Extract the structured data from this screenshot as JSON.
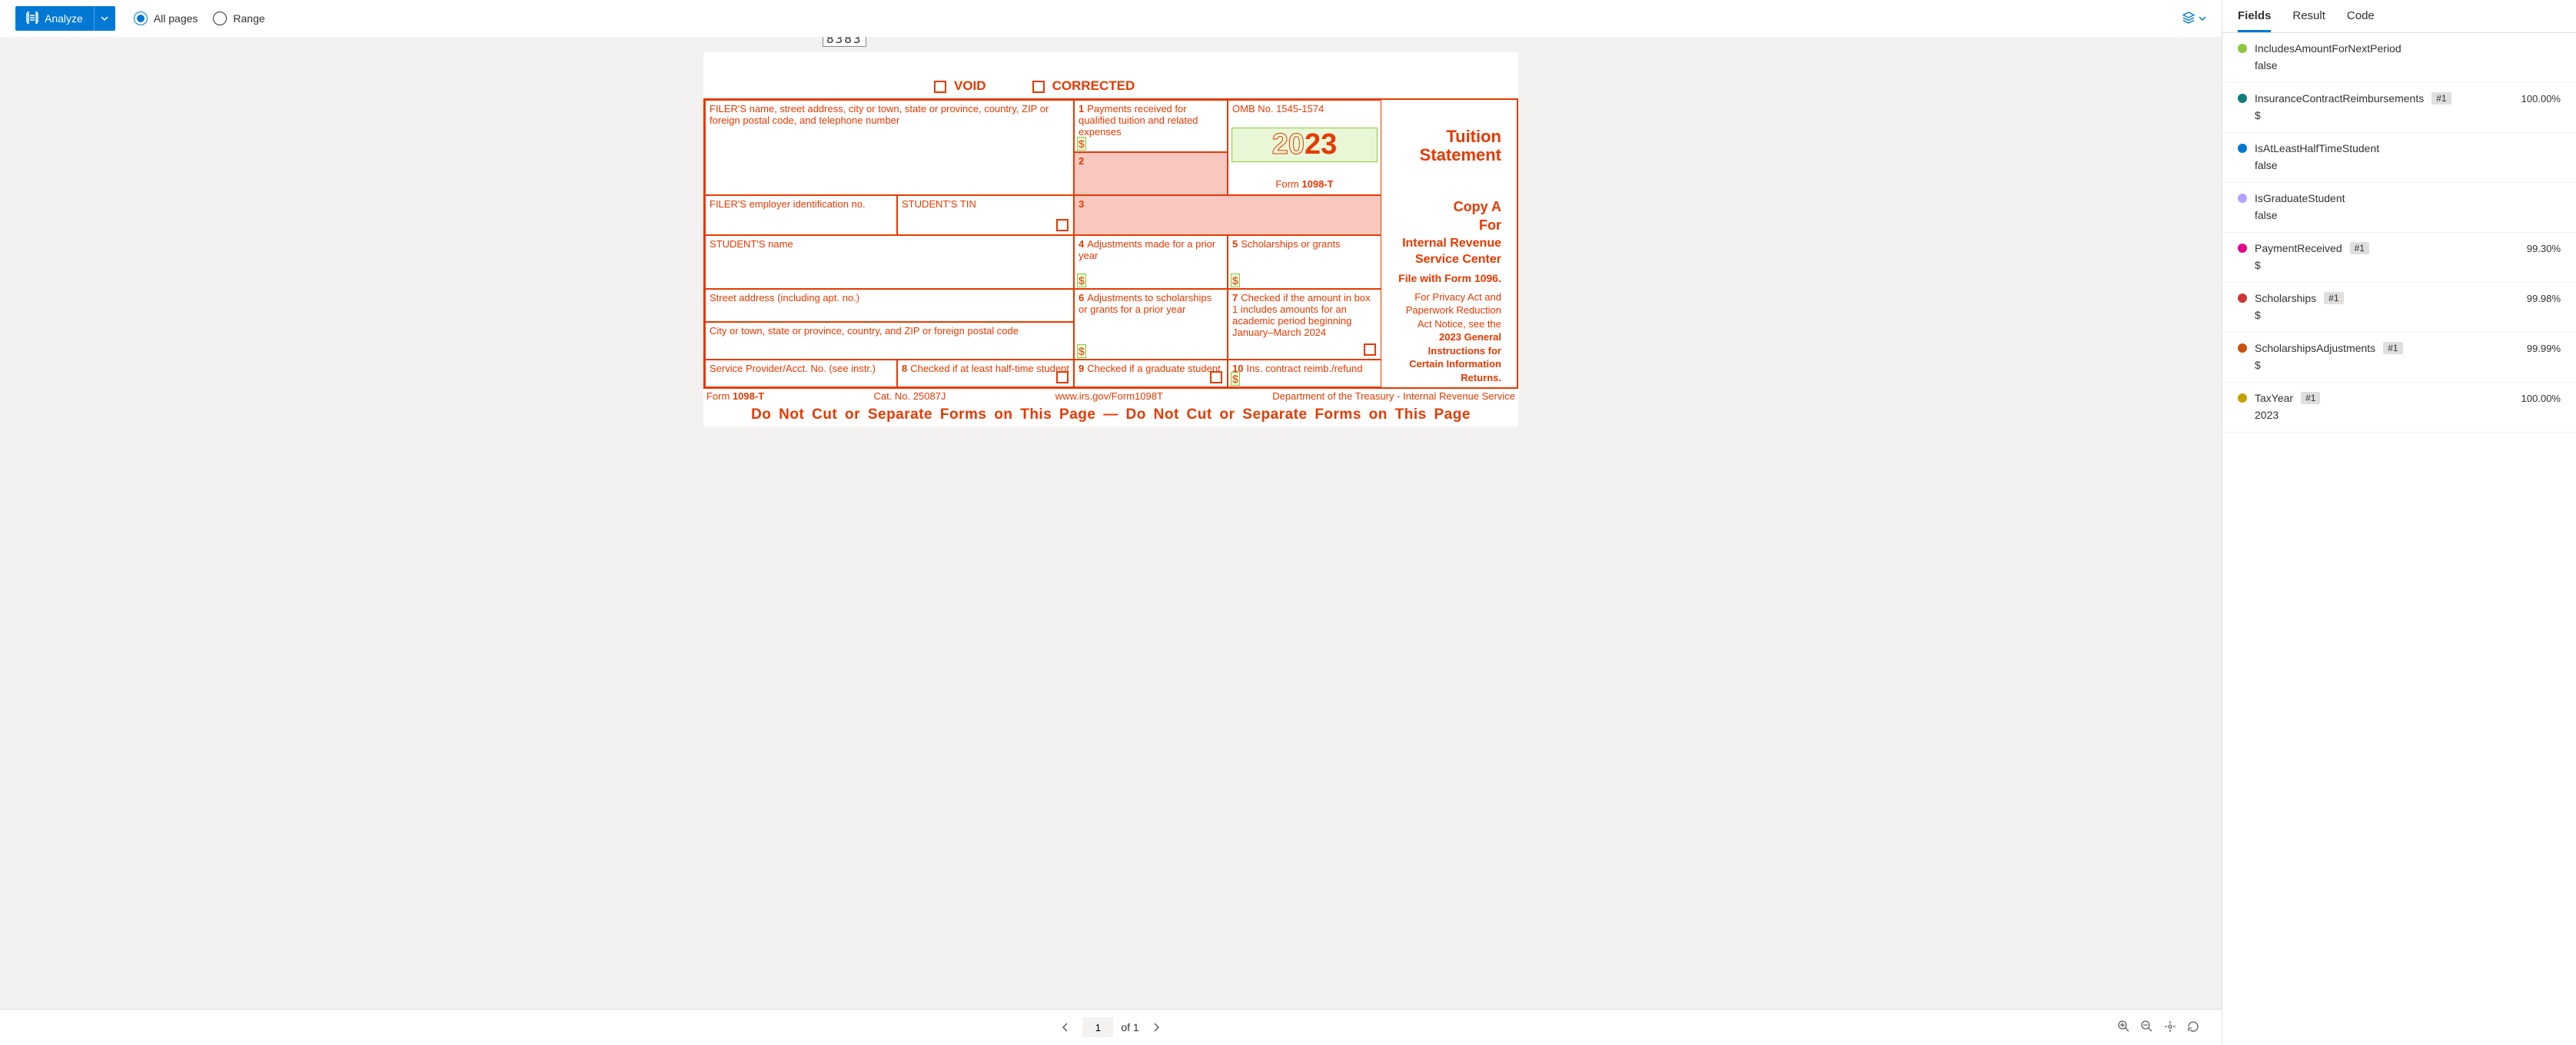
{
  "toolbar": {
    "analyze_label": "Analyze",
    "all_pages": "All pages",
    "range": "Range"
  },
  "tabs": {
    "fields": "Fields",
    "result": "Result",
    "code": "Code"
  },
  "form": {
    "ocr_badge": "8383",
    "void": "VOID",
    "corrected": "CORRECTED",
    "filer_name_label": "FILER'S name, street address, city or town, state or province, country, ZIP or foreign postal code, and telephone number",
    "box1_label": "Payments received for qualified tuition and related expenses",
    "omb": "OMB No. 1545-1574",
    "year": "2023",
    "form_no": "Form 1098-T",
    "title1": "Tuition",
    "title2": "Statement",
    "filer_ein": "FILER'S employer identification no.",
    "student_tin": "STUDENT'S TIN",
    "student_name": "STUDENT'S name",
    "box4": "Adjustments made for a prior year",
    "box5": "Scholarships or grants",
    "street": "Street address (including apt. no.)",
    "box6": "Adjustments to scholarships or grants for a prior year",
    "box7": "Checked if the amount in box 1 includes amounts for an academic period beginning January–March 2024",
    "city": "City or town, state or province, country, and ZIP or foreign postal code",
    "svc": "Service Provider/Acct. No. (see instr.)",
    "box8": "Checked if at least half-time student",
    "box9": "Checked if a graduate student",
    "box10": "Ins. contract reimb./refund",
    "copy_a": "Copy A",
    "for": "For",
    "irs1": "Internal Revenue",
    "irs2": "Service Center",
    "file_with": "File with Form 1096.",
    "priv1": "For Privacy Act and",
    "priv2": "Paperwork Reduction",
    "priv3": "Act Notice, see the",
    "priv4": "2023 General",
    "priv5": "Instructions for",
    "priv6": "Certain Information",
    "priv7": "Returns.",
    "footer_form": "Form 1098-T",
    "footer_cat": "Cat. No. 25087J",
    "footer_url": "www.irs.gov/Form1098T",
    "footer_dept": "Department of the Treasury - Internal Revenue Service",
    "warning": "Do Not Cut or Separate Forms on This Page   —   Do Not Cut or Separate Forms on This Page"
  },
  "pager": {
    "page": "1",
    "of_total": "of 1"
  },
  "fields": [
    {
      "color": "#8cc63f",
      "name": "IncludesAmountForNextPeriod",
      "badge": "",
      "conf": "",
      "value": "false"
    },
    {
      "color": "#107c7c",
      "name": "InsuranceContractReimbursements",
      "badge": "#1",
      "conf": "100.00%",
      "value": "$"
    },
    {
      "color": "#0078d4",
      "name": "IsAtLeastHalfTimeStudent",
      "badge": "",
      "conf": "",
      "value": "false"
    },
    {
      "color": "#b4a0ff",
      "name": "IsGraduateStudent",
      "badge": "",
      "conf": "",
      "value": "false"
    },
    {
      "color": "#e3008c",
      "name": "PaymentReceived",
      "badge": "#1",
      "conf": "99.30%",
      "value": "$"
    },
    {
      "color": "#d13438",
      "name": "Scholarships",
      "badge": "#1",
      "conf": "99.98%",
      "value": "$"
    },
    {
      "color": "#ca5010",
      "name": "ScholarshipsAdjustments",
      "badge": "#1",
      "conf": "99.99%",
      "value": "$"
    },
    {
      "color": "#c2a100",
      "name": "TaxYear",
      "badge": "#1",
      "conf": "100.00%",
      "value": "2023"
    }
  ]
}
